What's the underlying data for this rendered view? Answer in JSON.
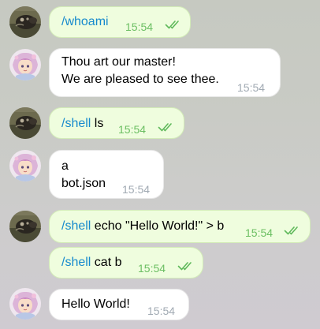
{
  "colors": {
    "outgoing_bubble": "#effdde",
    "incoming_bubble": "#ffffff",
    "command": "#168acd",
    "outgoing_time": "#6cbf63",
    "incoming_time": "#a1aab3"
  },
  "messages": [
    {
      "direction": "outgoing",
      "command": "/whoami",
      "rest": "",
      "time": "15:54",
      "status_icon": "double-check-icon"
    },
    {
      "direction": "incoming",
      "lines": [
        "Thou art our master!",
        "We are pleased to see thee."
      ],
      "time": "15:54"
    },
    {
      "direction": "outgoing",
      "command": "/shell",
      "rest": " ls",
      "time": "15:54",
      "status_icon": "double-check-icon"
    },
    {
      "direction": "incoming",
      "lines": [
        "a",
        "bot.json"
      ],
      "time": "15:54"
    },
    {
      "direction": "outgoing",
      "command": "/shell",
      "rest": " echo \"Hello World!\" > b",
      "time": "15:54",
      "status_icon": "double-check-icon"
    },
    {
      "direction": "outgoing",
      "command": "/shell",
      "rest": " cat b",
      "time": "15:54",
      "status_icon": "double-check-icon"
    },
    {
      "direction": "incoming",
      "lines": [
        "Hello World!"
      ],
      "time": "15:54"
    }
  ]
}
